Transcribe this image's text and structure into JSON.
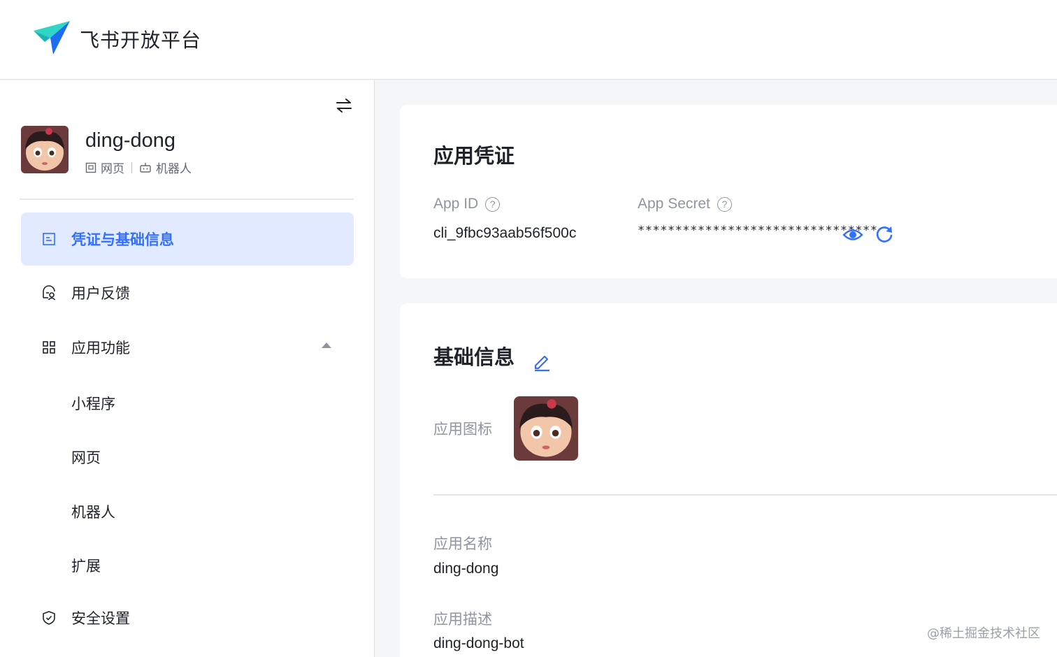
{
  "header": {
    "brand": "飞书开放平台",
    "logo_icon": "feishu-paper-plane-icon"
  },
  "sidebar": {
    "app_name": "ding-dong",
    "tags": [
      {
        "icon": "webpage-icon",
        "label": "网页"
      },
      {
        "icon": "robot-icon",
        "label": "机器人"
      }
    ],
    "nav": [
      {
        "icon": "credential-icon",
        "label": "凭证与基础信息",
        "active": true
      },
      {
        "icon": "feedback-icon",
        "label": "用户反馈"
      },
      {
        "icon": "grid-icon",
        "label": "应用功能",
        "expanded": true
      },
      {
        "label": "小程序",
        "sub": true
      },
      {
        "label": "网页",
        "sub": true
      },
      {
        "label": "机器人",
        "sub": true
      },
      {
        "label": "扩展",
        "sub": true
      },
      {
        "icon": "shield-icon",
        "label": "安全设置"
      }
    ]
  },
  "credentials": {
    "title": "应用凭证",
    "app_id_label": "App ID",
    "app_id_value": "cli_9fbc93aab56f500c",
    "app_secret_label": "App Secret",
    "app_secret_value": "********************************"
  },
  "basic_info": {
    "title": "基础信息",
    "icon_label": "应用图标",
    "name_label": "应用名称",
    "name_value": "ding-dong",
    "desc_label": "应用描述",
    "desc_value": "ding-dong-bot"
  },
  "watermark": "@稀土掘金技术社区",
  "colors": {
    "accent": "#3370ff",
    "active_bg": "#e1eaff",
    "muted_text": "#8f959e",
    "page_bg": "#f5f6f7"
  }
}
